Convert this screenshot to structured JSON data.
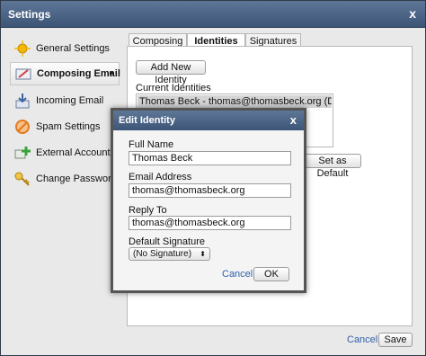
{
  "window": {
    "title": "Settings",
    "close_glyph": "x"
  },
  "sidebar": {
    "items": [
      {
        "label": "General Settings",
        "icon": "sun-icon",
        "color": "#f5b800"
      },
      {
        "label": "Composing Email",
        "icon": "pencil-icon",
        "color": "#6b7a99",
        "active": true
      },
      {
        "label": "Incoming Email",
        "icon": "arrow-down-icon",
        "color": "#3e64a6"
      },
      {
        "label": "Spam Settings",
        "icon": "prohibited-icon",
        "color": "#e07a1f"
      },
      {
        "label": "External Accounts",
        "icon": "add-account-icon",
        "color": "#3aa33a"
      },
      {
        "label": "Change Password",
        "icon": "key-icon",
        "color": "#d9a21b"
      }
    ],
    "chevron": "▸"
  },
  "tabs": [
    {
      "label": "Composing"
    },
    {
      "label": "Identities",
      "active": true
    },
    {
      "label": "Signatures"
    }
  ],
  "identities": {
    "add_button": "Add New Identity",
    "current_label": "Current Identities",
    "rows": [
      "Thomas Beck - thomas@thomasbeck.org (Default)"
    ],
    "set_default_button": "Set as Default"
  },
  "footer": {
    "cancel": "Cancel",
    "save": "Save"
  },
  "dialog": {
    "title": "Edit Identity",
    "close_glyph": "x",
    "full_name_label": "Full Name",
    "full_name_value": "Thomas Beck",
    "email_label": "Email Address",
    "email_value": "thomas@thomasbeck.org",
    "reply_to_label": "Reply To",
    "reply_to_value": "thomas@thomasbeck.org",
    "signature_label": "Default Signature",
    "signature_value": "(No Signature)",
    "select_arrows": "⬍",
    "cancel": "Cancel",
    "ok": "OK"
  },
  "colors": {
    "titlebar": "#4a6488",
    "link": "#2f5ea8"
  }
}
